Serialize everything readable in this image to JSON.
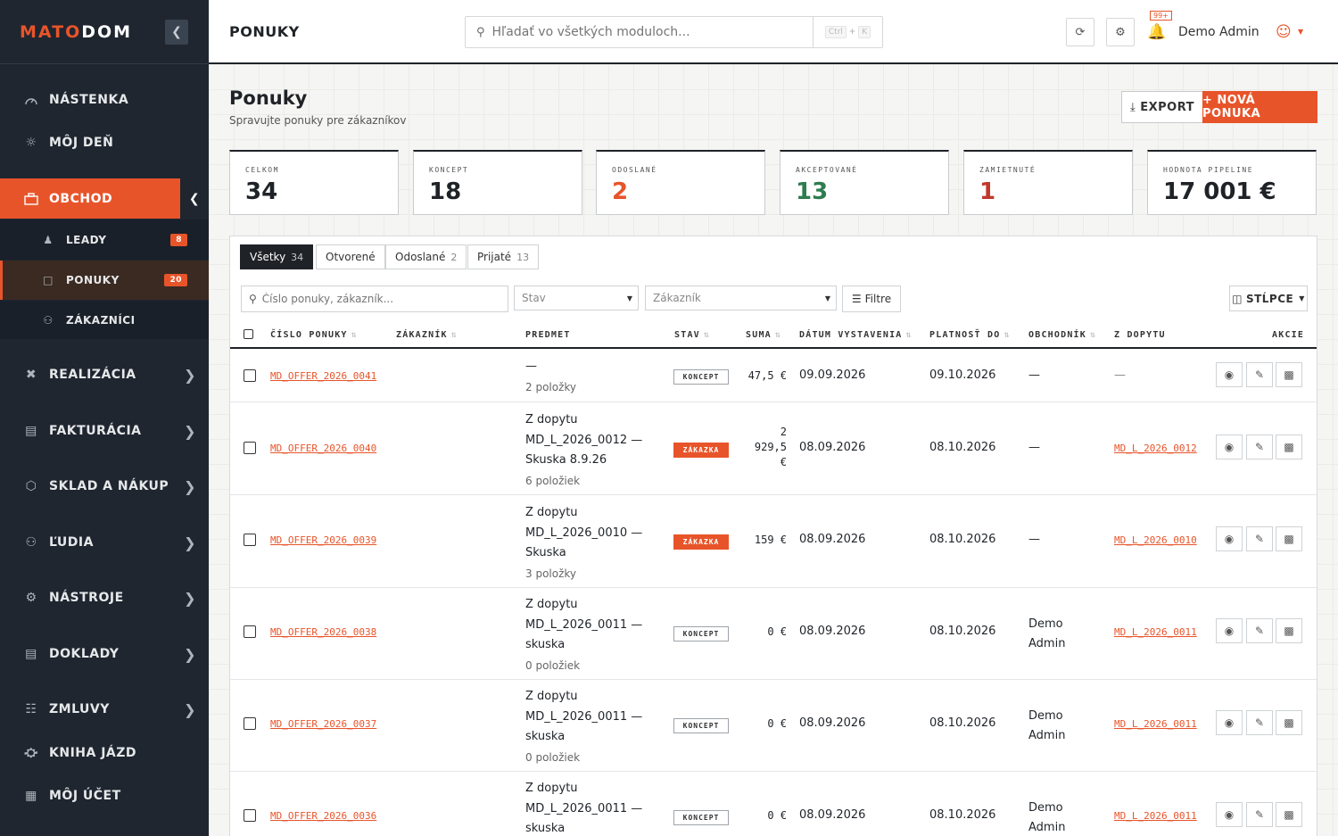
{
  "app": {
    "logo_part1": "MATO",
    "logo_part2": "DOM",
    "brand_color": "#e8542a"
  },
  "sidebar": {
    "items": [
      {
        "label": "NÁSTENKA",
        "icon": "dashboard-icon"
      },
      {
        "label": "MÔJ DEŇ",
        "icon": "sun-icon"
      },
      {
        "label": "OBCHOD",
        "icon": "briefcase-icon",
        "active": true
      },
      {
        "label": "REALIZÁCIA",
        "icon": "tools-icon"
      },
      {
        "label": "FAKTURÁCIA",
        "icon": "invoice-icon"
      },
      {
        "label": "SKLAD A NÁKUP",
        "icon": "box-icon"
      },
      {
        "label": "ĽUDIA",
        "icon": "people-icon"
      },
      {
        "label": "NÁSTROJE",
        "icon": "gear-icon"
      },
      {
        "label": "DOKLADY",
        "icon": "document-icon"
      },
      {
        "label": "ZMLUVY",
        "icon": "contract-icon"
      },
      {
        "label": "KNIHA JÁZD",
        "icon": "car-icon"
      },
      {
        "label": "MÔJ ÚČET",
        "icon": "id-card-icon"
      }
    ],
    "sub_items": [
      {
        "label": "LEADY",
        "badge": "8",
        "icon": "user-list-icon"
      },
      {
        "label": "PONUKY",
        "badge": "20",
        "icon": "file-icon",
        "active": true
      },
      {
        "label": "ZÁKAZNÍCI",
        "icon": "users-icon"
      }
    ]
  },
  "topbar": {
    "page_label": "PONUKY",
    "search_placeholder": "Hľadať vo všetkých moduloch...",
    "shortcut_ctrl": "Ctrl",
    "shortcut_plus": "+",
    "shortcut_key": "K",
    "notification_count": "99+",
    "user_name": "Demo Admin"
  },
  "page": {
    "title": "Ponuky",
    "subtitle": "Spravujte ponuky pre zákazníkov",
    "export_label": "EXPORT",
    "new_label": "+ NOVÁ PONUKA"
  },
  "stats": [
    {
      "label": "CELKOM",
      "value": "34",
      "color": "#1f2328"
    },
    {
      "label": "KONCEPT",
      "value": "18",
      "color": "#1f2328"
    },
    {
      "label": "ODOSLANÉ",
      "value": "2",
      "color": "#e8542a"
    },
    {
      "label": "AKCEPTOVANÉ",
      "value": "13",
      "color": "#2e7d4f"
    },
    {
      "label": "ZAMIETNUTÉ",
      "value": "1",
      "color": "#c0392b"
    },
    {
      "label": "HODNOTA PIPELINE",
      "value": "17 001 €",
      "color": "#1f2328"
    }
  ],
  "tabs": [
    {
      "label": "Všetky",
      "count": "34",
      "active": true
    },
    {
      "label": "Otvorené",
      "count": ""
    },
    {
      "label": "Odoslané",
      "count": "2"
    },
    {
      "label": "Prijaté",
      "count": "13"
    }
  ],
  "filters": {
    "search_placeholder": "Číslo ponuky, zákazník...",
    "status_placeholder": "Stav",
    "customer_placeholder": "Zákazník",
    "filters_label": "Filtre",
    "columns_label": "STĹPCE"
  },
  "table": {
    "columns": [
      "ČÍSLO PONUKY",
      "ZÁKAZNÍK",
      "PREDMET",
      "STAV",
      "SUMA",
      "DÁTUM VYSTAVENIA",
      "PLATNOSŤ DO",
      "OBCHODNÍK",
      "Z DOPYTU",
      "AKCIE"
    ],
    "rows": [
      {
        "number": "MD_OFFER_2026_0041",
        "customer": "",
        "subject": "—",
        "items": "2 položky",
        "status": "KONCEPT",
        "status_type": "draft",
        "sum": "47,5 €",
        "issued": "09.09.2026",
        "valid": "09.10.2026",
        "salesman": "—",
        "from_inquiry": "—"
      },
      {
        "number": "MD_OFFER_2026_0040",
        "customer": "",
        "subject": "Z dopytu MD_L_2026_0012 — Skuska 8.9.26",
        "items": "6 položiek",
        "status": "ZÁKAZKA",
        "status_type": "order",
        "sum": "2 929,5 €",
        "issued": "08.09.2026",
        "valid": "08.10.2026",
        "salesman": "—",
        "from_inquiry": "MD_L_2026_0012"
      },
      {
        "number": "MD_OFFER_2026_0039",
        "customer": "",
        "subject": "Z dopytu MD_L_2026_0010 — Skuska",
        "items": "3 položky",
        "status": "ZÁKAZKA",
        "status_type": "order",
        "sum": "159 €",
        "issued": "08.09.2026",
        "valid": "08.10.2026",
        "salesman": "—",
        "from_inquiry": "MD_L_2026_0010"
      },
      {
        "number": "MD_OFFER_2026_0038",
        "customer": "",
        "subject": "Z dopytu MD_L_2026_0011 — skuska",
        "items": "0 položiek",
        "status": "KONCEPT",
        "status_type": "draft",
        "sum": "0 €",
        "issued": "08.09.2026",
        "valid": "08.10.2026",
        "salesman": "Demo Admin",
        "from_inquiry": "MD_L_2026_0011"
      },
      {
        "number": "MD_OFFER_2026_0037",
        "customer": "",
        "subject": "Z dopytu MD_L_2026_0011 — skuska",
        "items": "0 položiek",
        "status": "KONCEPT",
        "status_type": "draft",
        "sum": "0 €",
        "issued": "08.09.2026",
        "valid": "08.10.2026",
        "salesman": "Demo Admin",
        "from_inquiry": "MD_L_2026_0011"
      },
      {
        "number": "MD_OFFER_2026_0036",
        "customer": "",
        "subject": "Z dopytu MD_L_2026_0011 — skuska",
        "items": "",
        "status": "KONCEPT",
        "status_type": "draft",
        "sum": "0 €",
        "issued": "08.09.2026",
        "valid": "08.10.2026",
        "salesman": "Demo Admin",
        "from_inquiry": "MD_L_2026_0011"
      }
    ]
  }
}
